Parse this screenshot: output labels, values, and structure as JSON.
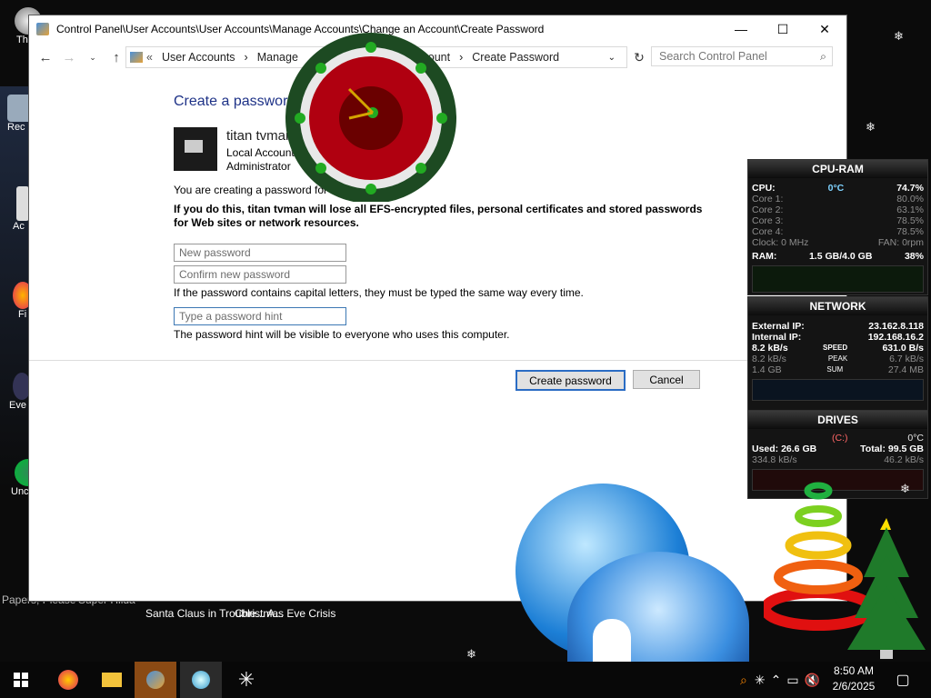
{
  "desktop": {
    "icons": [
      {
        "name": "desktop-icon-this-pc",
        "label": "Th"
      },
      {
        "name": "desktop-icon-recycle",
        "label": "Rec"
      },
      {
        "name": "desktop-icon-ac",
        "label": "Ac"
      },
      {
        "name": "desktop-icon-fi",
        "label": "Fi"
      },
      {
        "name": "desktop-icon-eve",
        "label": "Eve"
      },
      {
        "name": "desktop-icon-unc",
        "label": "Unc"
      }
    ],
    "bottom_labels": [
      "Papers, Please",
      "Super Hilda",
      "Santa Claus in Trouble... A...",
      "Christmas Eve Crisis"
    ]
  },
  "window": {
    "title": "Control Panel\\User Accounts\\User Accounts\\Manage Accounts\\Change an Account\\Create Password",
    "breadcrumbs": [
      "User Accounts",
      "Manage",
      "Account",
      "Create Password"
    ],
    "search_placeholder": "Search Control Panel",
    "heading": "Create a password",
    "user": {
      "name": "titan tvman",
      "type": "Local Account",
      "role": "Administrator"
    },
    "intro": "You are creating a password for titan tvman.",
    "warning": "If you do this, titan tvman will lose all EFS-encrypted files, personal certificates and stored passwords for Web sites or network resources.",
    "new_password_placeholder": "New password",
    "confirm_password_placeholder": "Confirm new password",
    "caps_note": "If the password contains capital letters, they must be typed the same way every time.",
    "hint_placeholder": "Type a password hint",
    "hint_note": "The password hint will be visible to everyone who uses this computer.",
    "create_button": "Create password",
    "cancel_button": "Cancel"
  },
  "cpu_ram": {
    "title": "CPU-RAM",
    "cpu": {
      "label": "CPU:",
      "temp": "0°C",
      "pct": "74.7%"
    },
    "cores": [
      {
        "label": "Core 1:",
        "pct": "80.0%"
      },
      {
        "label": "Core 2:",
        "pct": "63.1%"
      },
      {
        "label": "Core 3:",
        "pct": "78.5%"
      },
      {
        "label": "Core 4:",
        "pct": "78.5%"
      }
    ],
    "clock": {
      "label": "Clock: 0 MHz",
      "fan": "FAN: 0rpm"
    },
    "ram": {
      "label": "RAM:",
      "value": "1.5 GB/4.0 GB",
      "pct": "38%"
    }
  },
  "network": {
    "title": "NETWORK",
    "external": {
      "label": "External IP:",
      "value": "23.162.8.118"
    },
    "internal": {
      "label": "Internal IP:",
      "value": "192.168.16.2"
    },
    "speed": {
      "left": "8.2 kB/s",
      "label": "SPEED",
      "right": "631.0 B/s"
    },
    "peak": {
      "left": "8.2 kB/s",
      "label": "PEAK",
      "right": "6.7 kB/s"
    },
    "sum": {
      "left": "1.4 GB",
      "label": "SUM",
      "right": "27.4 MB"
    }
  },
  "drives": {
    "title": "DRIVES",
    "letter": "(C:)",
    "temp": "0°C",
    "used": "Used: 26.6 GB",
    "total": "Total: 99.5 GB",
    "read": "334.8 kB/s",
    "write": "46.2 kB/s"
  },
  "taskbar": {
    "time": "8:50 AM",
    "date": "2/6/2025"
  },
  "colors": {
    "accent": "#1e3287",
    "button_focus": "#2a6cc4"
  }
}
